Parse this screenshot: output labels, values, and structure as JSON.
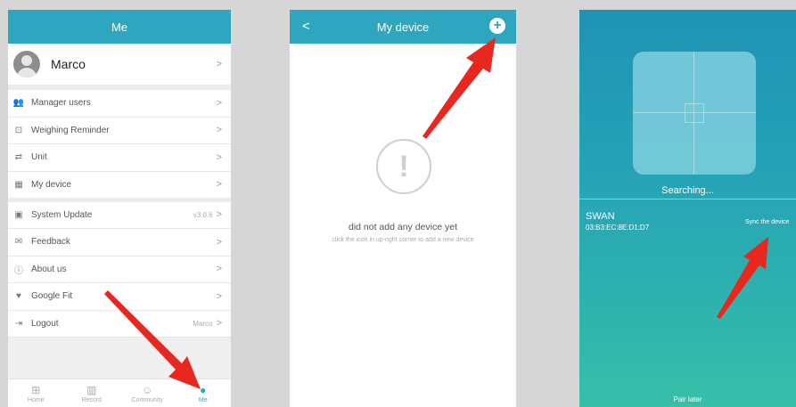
{
  "me_screen": {
    "title": "Me",
    "profile_name": "Marco",
    "rows": [
      {
        "label": "Manager users",
        "icon": "users-icon",
        "value": ""
      },
      {
        "label": "Weighing Reminder",
        "icon": "reminder-icon",
        "value": ""
      },
      {
        "label": "Unit",
        "icon": "unit-icon",
        "value": ""
      },
      {
        "label": "My device",
        "icon": "device-icon",
        "value": ""
      },
      {
        "label": "System Update",
        "icon": "update-icon",
        "value": "v3.0.6"
      },
      {
        "label": "Feedback",
        "icon": "feedback-icon",
        "value": ""
      },
      {
        "label": "About us",
        "icon": "info-icon",
        "value": ""
      },
      {
        "label": "Google Fit",
        "icon": "heart-icon",
        "value": ""
      },
      {
        "label": "Logout",
        "icon": "logout-icon",
        "value": "Marco"
      }
    ],
    "tabs": [
      {
        "label": "Home",
        "icon": "grid-icon"
      },
      {
        "label": "Record",
        "icon": "bar-chart-icon"
      },
      {
        "label": "Community",
        "icon": "smiley-icon"
      },
      {
        "label": "Me",
        "icon": "person-icon"
      }
    ],
    "chevron": ">"
  },
  "device_screen": {
    "title": "My device",
    "back": "<",
    "add": "+",
    "empty_title": "did not add any device yet",
    "empty_hint": "click the icon in up-right corner to add a new device",
    "warning_glyph": "!"
  },
  "search_screen": {
    "status": "Searching...",
    "device_name": "SWAN",
    "device_mac": "03:B3:EC:8E:D1:D7",
    "sync_label": "Sync the device",
    "pair_later": "Pair later"
  },
  "colors": {
    "header": "#2ea6c0",
    "arrow": "#e8271f"
  }
}
